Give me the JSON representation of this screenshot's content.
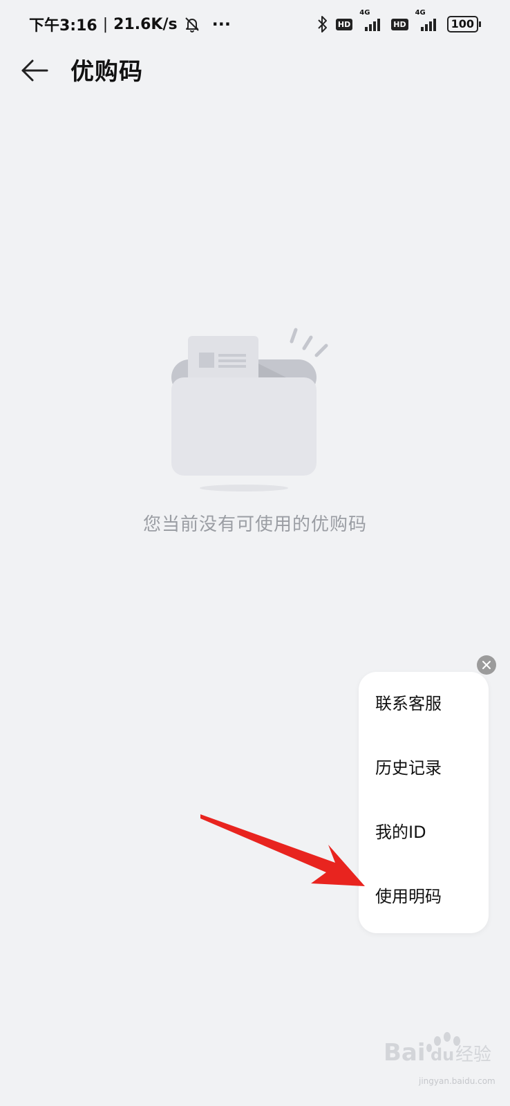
{
  "status_bar": {
    "time": "下午3:16",
    "network_speed": "21.6K/s",
    "separator": "|",
    "more_dots": "···",
    "bluetooth_icon": "bluetooth-icon",
    "hd_label": "HD",
    "network_type": "4G",
    "battery": "100"
  },
  "header": {
    "back_icon": "back-arrow-icon",
    "title": "优购码"
  },
  "empty_state": {
    "illustration": "empty-envelope-illustration",
    "message": "您当前没有可使用的优购码"
  },
  "menu": {
    "close_icon": "close-icon",
    "items": [
      {
        "label": "联系客服"
      },
      {
        "label": "历史记录"
      },
      {
        "label": "我的ID"
      },
      {
        "label": "使用明码"
      }
    ]
  },
  "overlay": {
    "arrow_color": "#e8241f"
  },
  "watermark": {
    "brand": "Bai",
    "brand2": "du",
    "cn": "经验",
    "url": "jingyan.baidu.com"
  },
  "colors": {
    "background": "#f1f2f4",
    "panel": "#ffffff",
    "muted_text": "#9a9da3",
    "close_badge": "#9b9b9b"
  }
}
